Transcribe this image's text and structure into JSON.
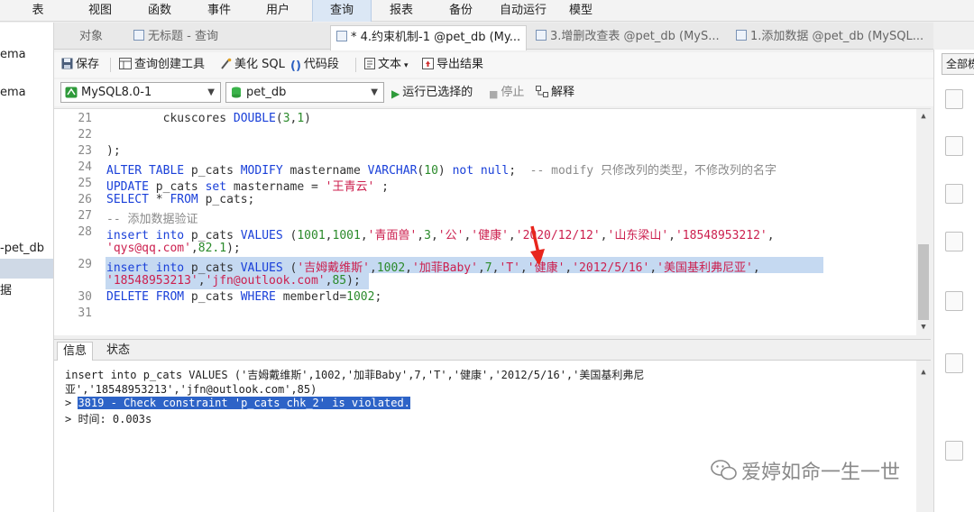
{
  "menu": [
    "表",
    "视图",
    "函数",
    "事件",
    "用户",
    "查询",
    "报表",
    "备份",
    "自动运行",
    "模型"
  ],
  "menu_active_index": 5,
  "left_nav": [
    "ema",
    "ema",
    "-pet_db",
    "据"
  ],
  "tabs": [
    {
      "label": "对象"
    },
    {
      "label": "无标题 - 查询"
    },
    {
      "label": "* 4.约束机制-1 @pet_db (My..."
    },
    {
      "label": "3.增删改查表 @pet_db (MyS..."
    },
    {
      "label": "1.添加数据 @pet_db (MySQL..."
    }
  ],
  "toolbar": {
    "save": "保存",
    "query_builder": "查询创建工具",
    "beautify": "美化 SQL",
    "snippet": "代码段",
    "text": "文本",
    "export": "导出结果"
  },
  "connection": {
    "value": "MySQL8.0-1"
  },
  "database": {
    "value": "pet_db"
  },
  "run": {
    "run_selected": "运行已选择的",
    "stop": "停止",
    "explain": "解释"
  },
  "editor": {
    "lines": [
      {
        "num": "21",
        "text": "        ckuscores DOUBLE(3,1)"
      },
      {
        "num": "22",
        "text": ""
      },
      {
        "num": "23",
        "text": ");"
      },
      {
        "num": "24",
        "text": "ALTER TABLE p_cats MODIFY mastername VARCHAR(10) not null;  -- modify 只修改列的类型，不修改列的名字"
      },
      {
        "num": "25",
        "text": "UPDATE p_cats set mastername = '王青云' ;"
      },
      {
        "num": "26",
        "text": "SELECT * FROM p_cats;"
      },
      {
        "num": "27",
        "text": "-- 添加数据验证"
      },
      {
        "num": "28",
        "text": "insert into p_cats VALUES (1001,1001,'青面兽',3,'公','健康','2020/12/12','山东梁山','18548953212',"
      },
      {
        "num": "",
        "text": "'qys@qq.com',82.1);"
      },
      {
        "num": "29",
        "text": "insert into p_cats VALUES ('吉姆戴维斯',1002,'加菲Baby',7,'T','健康','2012/5/16','美国基利弗尼亚',"
      },
      {
        "num": "",
        "text": "'18548953213','jfn@outlook.com',85);"
      },
      {
        "num": "30",
        "text": "DELETE FROM p_cats WHERE memberld=1002;"
      },
      {
        "num": "31",
        "text": ""
      }
    ]
  },
  "result_tabs": [
    "信息",
    "状态"
  ],
  "result": {
    "line1": "insert into p_cats VALUES ('吉姆戴维斯',1002,'加菲Baby',7,'T','健康','2012/5/16','美国基利弗尼",
    "line2": "亚','18548953213','jfn@outlook.com',85)",
    "prompt1": "> ",
    "error": "3819 - Check constraint 'p_cats_chk_2' is violated.",
    "prompt2": "> ",
    "time": "时间: 0.003s"
  },
  "right_panel": {
    "header": "全部栋"
  },
  "watermark": "爱婷如命一生一世",
  "colors": {
    "keyword": "#1a40d9",
    "string": "#cc1f4e",
    "number": "#2a8a2a",
    "comment": "#8a8a8a",
    "selection": "#c5d9f1",
    "error_selection": "#2d63c7",
    "arrow": "#e8251c"
  },
  "icons": [
    "save-icon",
    "query-builder-icon",
    "beautify-icon",
    "snippet-icon",
    "text-icon",
    "export-icon",
    "run-icon",
    "stop-icon",
    "explain-icon",
    "connection-icon",
    "database-icon",
    "query-tab-icon",
    "red-arrow-icon",
    "wechat-icon"
  ]
}
